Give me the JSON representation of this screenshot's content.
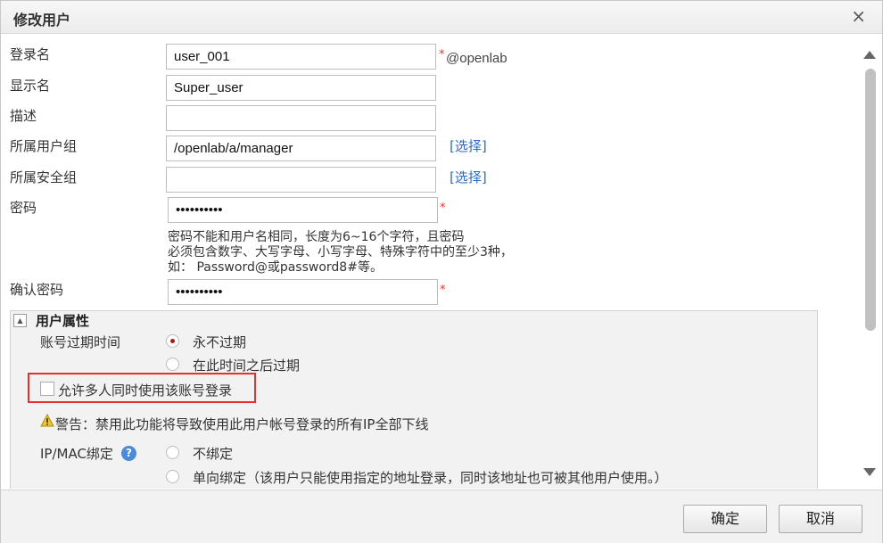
{
  "dialog": {
    "title": "修改用户",
    "close": "×"
  },
  "form": {
    "login_name": {
      "label": "登录名",
      "value": "user_001",
      "required": "*",
      "suffix": "@openlab"
    },
    "display_name": {
      "label": "显示名",
      "value": "Super_user"
    },
    "description": {
      "label": "描述",
      "value": ""
    },
    "user_group": {
      "label": "所属用户组",
      "value": "/openlab/a/manager",
      "select_link": "[选择]"
    },
    "security_group": {
      "label": "所属安全组",
      "value": "",
      "select_link": "[选择]"
    },
    "password": {
      "label": "密码",
      "value": "••••••••••",
      "required": "*"
    },
    "password_hint": {
      "line1": "密码不能和用户名相同，长度为6~16个字符，且密码",
      "line2": "必须包含数字、大写字母、小写字母、特殊字符中的至少3种，",
      "line3": "如： Password@或password8#等。"
    },
    "confirm_password": {
      "label": "确认密码",
      "value": "••••••••••",
      "required": "*"
    }
  },
  "user_attributes": {
    "title": "用户属性",
    "toggle_icon": "▲",
    "expiry": {
      "label": "账号过期时间",
      "options": [
        {
          "label": "永不过期",
          "selected": true
        },
        {
          "label": "在此时间之后过期",
          "selected": false
        }
      ]
    },
    "multi_login": {
      "label": "允许多人同时使用该账号登录",
      "checked": false
    },
    "warning": {
      "text": "警告：禁用此功能将导致使用此用户帐号登录的所有IP全部下线",
      "icon": "warning-icon"
    },
    "binding": {
      "label": "IP/MAC绑定",
      "help_icon": "?",
      "options": [
        {
          "label": "不绑定",
          "selected": false
        },
        {
          "label": "单向绑定（该用户只能使用指定的地址登录，同时该地址也可被其他用户使用。）",
          "selected": false
        }
      ]
    }
  },
  "footer": {
    "confirm_label": "确定",
    "cancel_label": "取消"
  },
  "colors": {
    "required": "#e33333",
    "link": "#2a6cc4",
    "highlight": "#e03030",
    "radio_selected": "#b01818"
  }
}
